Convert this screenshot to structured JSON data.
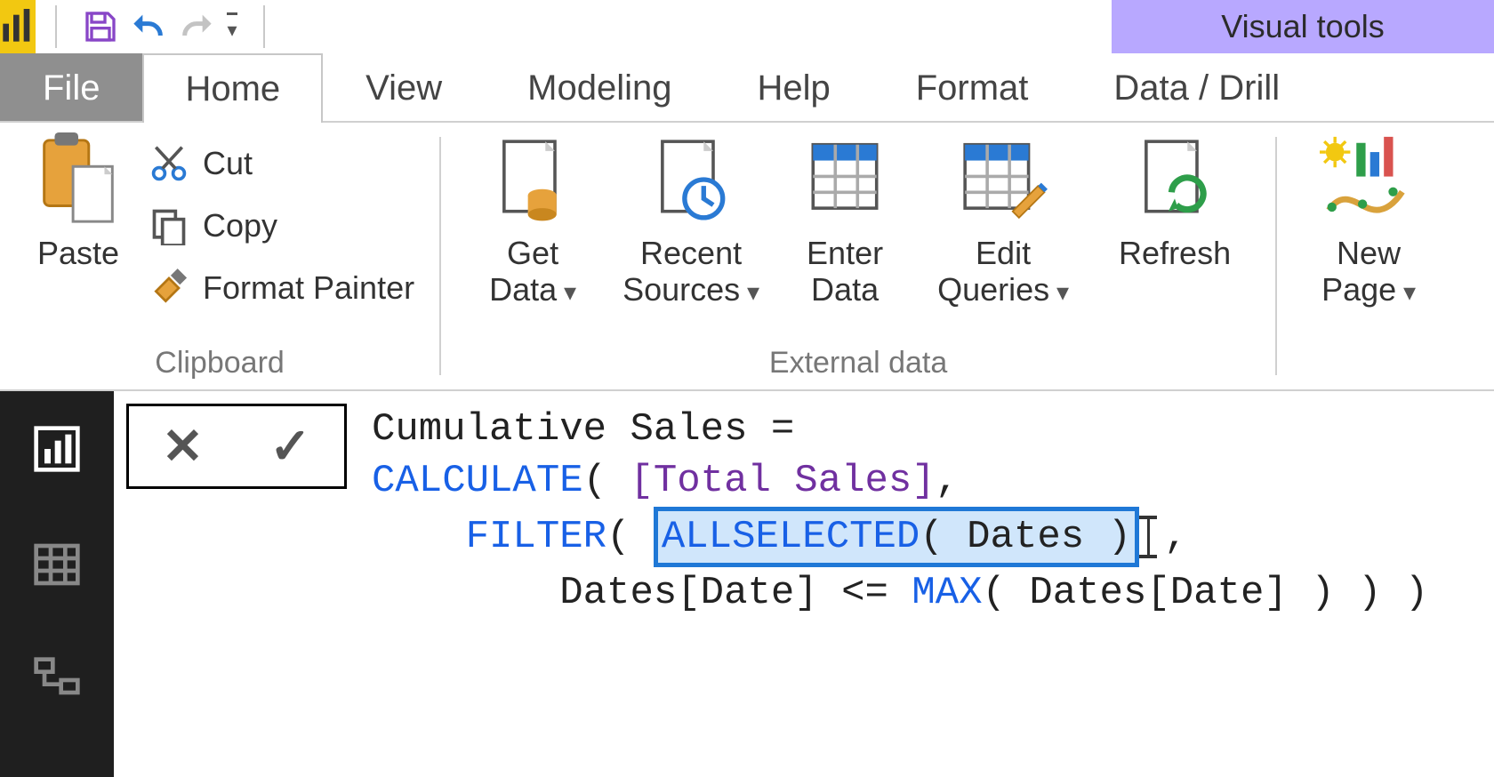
{
  "qat": {
    "contextual_tab": "Visual tools",
    "customize_glyph": "▾"
  },
  "tabs": {
    "file": "File",
    "home": "Home",
    "view": "View",
    "modeling": "Modeling",
    "help": "Help",
    "format": "Format",
    "data_drill": "Data / Drill"
  },
  "ribbon": {
    "clipboard": {
      "paste": "Paste",
      "cut": "Cut",
      "copy": "Copy",
      "format_painter": "Format Painter",
      "group_label": "Clipboard"
    },
    "external_data": {
      "get_data": "Get\nData",
      "recent_sources": "Recent\nSources",
      "enter_data": "Enter\nData",
      "edit_queries": "Edit\nQueries",
      "refresh": "Refresh",
      "group_label": "External data"
    },
    "insert": {
      "new_page": "New\nPage"
    }
  },
  "formula_bar": {
    "cancel_glyph": "✕",
    "commit_glyph": "✓"
  },
  "formula": {
    "line1_a": "Cumulative Sales = ",
    "line2_fn": "CALCULATE",
    "line2_open": "( ",
    "line2_meas": "[Total Sales]",
    "line2_close": ",",
    "line3_indent": "    ",
    "line3_fn": "FILTER",
    "line3_open": "( ",
    "line3_hl_fn": "ALLSELECTED",
    "line3_hl_arg": "( Dates )",
    "line3_comma": ",",
    "line4_indent": "        ",
    "line4_a": "Dates[Date] <= ",
    "line4_fn": "MAX",
    "line4_b": "( Dates[Date] ) ) )"
  }
}
